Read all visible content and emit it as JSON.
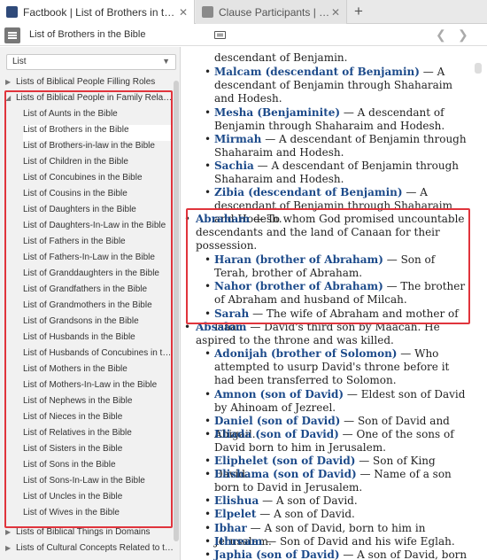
{
  "tabs": [
    {
      "label": "Factbook | List of Brothers in the Bible",
      "close": "✕"
    },
    {
      "label": "Clause Participants | אַבְרָם",
      "close": "✕"
    }
  ],
  "tab_add": "+",
  "address": {
    "title": "List of Brothers in the Bible",
    "back": "❮",
    "forward": "❯"
  },
  "sidebar": {
    "dropdown_value": "List",
    "dropdown_caret": "▼",
    "items": [
      {
        "label": "Lists of Biblical People Filling Roles",
        "arrow": "▶"
      },
      {
        "label": "Lists of Biblical People in Family Relationships",
        "arrow": "◢"
      },
      {
        "label": "List of Aunts in the Bible"
      },
      {
        "label": "List of Brothers in the Bible"
      },
      {
        "label": "List of Brothers-in-law in the Bible"
      },
      {
        "label": "List of Children in the Bible"
      },
      {
        "label": "List of Concubines in the Bible"
      },
      {
        "label": "List of Cousins in the Bible"
      },
      {
        "label": "List of Daughters in the Bible"
      },
      {
        "label": "List of Daughters-In-Law in the Bible"
      },
      {
        "label": "List of Fathers in the Bible"
      },
      {
        "label": "List of Fathers-In-Law in the Bible"
      },
      {
        "label": "List of Granddaughters in the Bible"
      },
      {
        "label": "List of Grandfathers in the Bible"
      },
      {
        "label": "List of Grandmothers in the Bible"
      },
      {
        "label": "List of Grandsons in the Bible"
      },
      {
        "label": "List of Husbands in the Bible"
      },
      {
        "label": "List of Husbands of Concubines in the Bible"
      },
      {
        "label": "List of Mothers in the Bible"
      },
      {
        "label": "List of Mothers-In-Law in the Bible"
      },
      {
        "label": "List of Nephews in the Bible"
      },
      {
        "label": "List of Nieces in the Bible"
      },
      {
        "label": "List of Relatives in the Bible"
      },
      {
        "label": "List of Sisters in the Bible"
      },
      {
        "label": "List of Sons in the Bible"
      },
      {
        "label": "List of Sons-In-Law in the Bible"
      },
      {
        "label": "List of Uncles in the Bible"
      },
      {
        "label": "List of Wives in the Bible"
      },
      {
        "label": "Lists of Biblical Things in Domains",
        "arrow": "▶"
      },
      {
        "label": "Lists of Cultural Concepts Related to the Bible",
        "arrow": "▶"
      }
    ]
  },
  "content": {
    "bullet": "•",
    "entries": [
      {
        "name": "",
        "desc": "descendant of Benjamin."
      },
      {
        "name": "Malcam (descendant of Benjamin)",
        "desc": " — A descendant of Benjamin through Shaharaim and Hodesh."
      },
      {
        "name": "Mesha (Benjaminite)",
        "desc": " — A descendant of Benjamin through Shaharaim and Hodesh."
      },
      {
        "name": "Mirmah",
        "desc": " — A descendant of Benjamin through Shaharaim and Hodesh."
      },
      {
        "name": "Sachia",
        "desc": " — A descendant of Benjamin through Shaharaim and Hodesh."
      },
      {
        "name": "Zibia (descendant of Benjamin)",
        "desc": " — A descendant of Benjamin through Shaharaim and Hodesh."
      },
      {
        "name": "Abraham",
        "desc": " — To whom God promised uncountable descendants and the land of Canaan for their possession."
      },
      {
        "name": "Haran (brother of Abraham)",
        "desc": " — Son of Terah, brother of Abraham."
      },
      {
        "name": "Nahor (brother of Abraham)",
        "desc": " — The brother of Abraham and husband of Milcah."
      },
      {
        "name": "Sarah",
        "desc": " — The wife of Abraham and mother of Isaac."
      },
      {
        "name": "Absalom",
        "desc": " — David's third son by Maacah. He aspired to the throne and was killed."
      },
      {
        "name": "Adonijah (brother of Solomon)",
        "desc": " — Who attempted to usurp David's throne before it had been transferred to Solomon."
      },
      {
        "name": "Amnon (son of David)",
        "desc": " — Eldest son of David by Ahinoam of Jezreel."
      },
      {
        "name": "Daniel (son of David)",
        "desc": " — Son of David and Abigail."
      },
      {
        "name": "Eliada (son of David)",
        "desc": " — One of the sons of David born to him in Jerusalem."
      },
      {
        "name": "Eliphelet (son of David)",
        "desc": " — Son of King David."
      },
      {
        "name": "Elishama (son of David)",
        "desc": " — Name of a son born to David in Jerusalem."
      },
      {
        "name": "Elishua",
        "desc": " — A son of David."
      },
      {
        "name": "Elpelet",
        "desc": " — A son of David."
      },
      {
        "name": "Ibhar",
        "desc": " — A son of David, born to him in Jerusalem."
      },
      {
        "name": "Ithream",
        "desc": " — Son of David and his wife Eglah."
      },
      {
        "name": "Japhia (son of David)",
        "desc": " — A son of David, born to him"
      }
    ]
  }
}
